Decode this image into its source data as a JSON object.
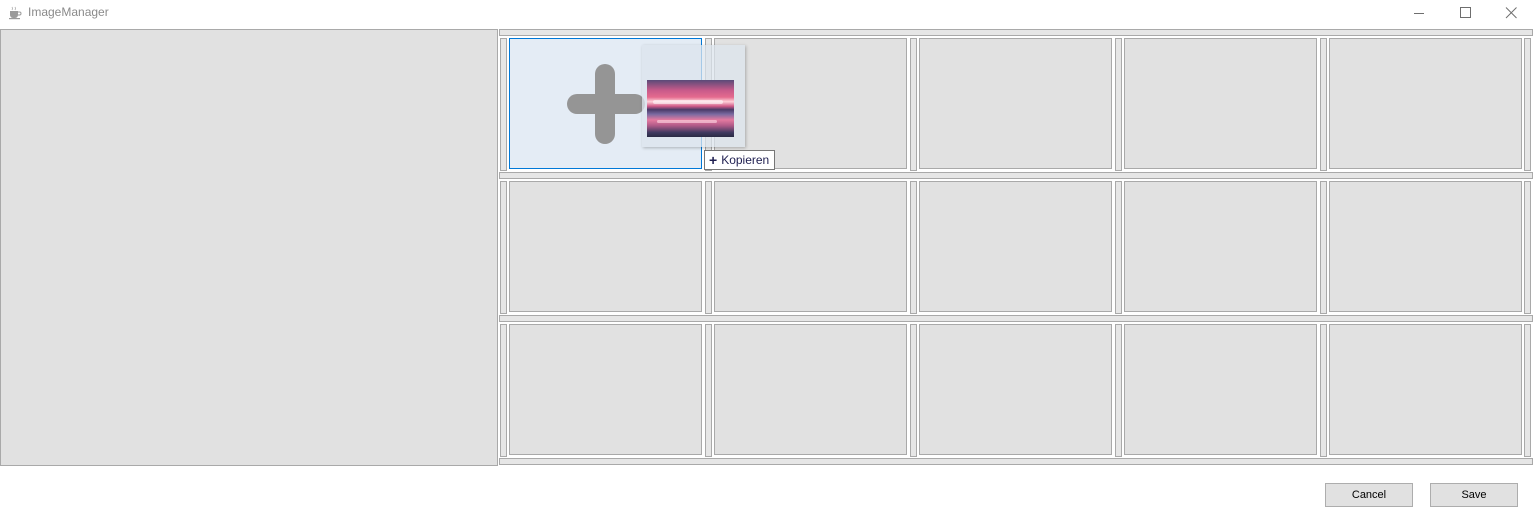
{
  "window": {
    "title": "ImageManager",
    "app_icon": "coffee-cup-icon",
    "controls": [
      "minimize-icon",
      "maximize-icon",
      "close-icon"
    ]
  },
  "grid": {
    "rows": 3,
    "columns": 5,
    "selected_cell": {
      "row": 1,
      "column": 1
    }
  },
  "drag": {
    "overlay_icon": "plus-icon",
    "tooltip_icon": "plus-icon",
    "tooltip_label": "Kopieren"
  },
  "buttons": {
    "cancel_label": "Cancel",
    "save_label": "Save"
  }
}
